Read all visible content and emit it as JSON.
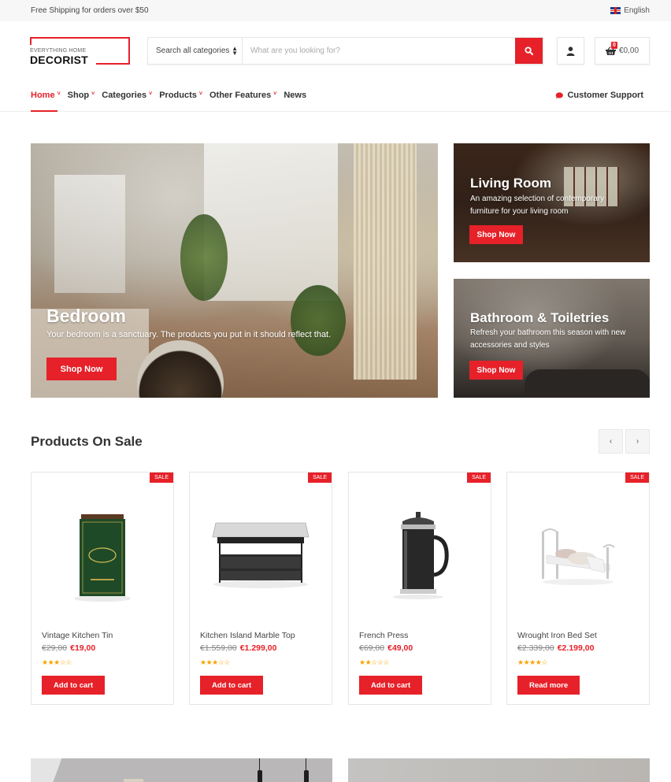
{
  "topbar": {
    "shipping_text": "Free Shipping for orders over $50",
    "language": "English",
    "language_icon": "uk-flag-icon"
  },
  "header": {
    "logo": {
      "tagline": "EVERYTHING HOME",
      "name": "DECORIST"
    },
    "search": {
      "category_select": "Search all categories",
      "placeholder": "What are you looking for?",
      "value": "",
      "button_icon": "search-icon"
    },
    "account_icon": "user-icon",
    "cart": {
      "icon": "basket-icon",
      "count": "0",
      "total": "€0,00"
    }
  },
  "nav": {
    "items": [
      {
        "label": "Home",
        "dropdown": true,
        "active": true
      },
      {
        "label": "Shop",
        "dropdown": true
      },
      {
        "label": "Categories",
        "dropdown": true
      },
      {
        "label": "Products",
        "dropdown": true
      },
      {
        "label": "Other Features",
        "dropdown": true
      },
      {
        "label": "News",
        "dropdown": false
      }
    ],
    "support": {
      "label": "Customer Support",
      "icon": "chat-bubble-icon"
    }
  },
  "banners": [
    {
      "title": "Bedroom",
      "description": "Your bedroom is a sanctuary. The products you put in it should reflect that.",
      "button": "Shop Now"
    },
    {
      "title": "Living Room",
      "description": "An amazing selection of contemporary furniture for your living room",
      "button": "Shop Now"
    },
    {
      "title": "Bathroom & Toiletries",
      "description": "Refresh your bathroom this season with new accessories and styles",
      "button": "Shop Now"
    }
  ],
  "products_section": {
    "title": "Products On Sale",
    "prev_icon": "chevron-left-icon",
    "next_icon": "chevron-right-icon",
    "products": [
      {
        "badge": "SALE",
        "name": "Vintage Kitchen Tin",
        "old_price": "€29,00",
        "price": "€19,00",
        "rating": 3,
        "rating_max": 5,
        "button": "Add to cart"
      },
      {
        "badge": "SALE",
        "name": "Kitchen Island Marble Top",
        "old_price": "€1.559,00",
        "price": "€1.299,00",
        "rating": 3,
        "rating_max": 5,
        "button": "Add to cart"
      },
      {
        "badge": "SALE",
        "name": "French Press",
        "old_price": "€69,00",
        "price": "€49,00",
        "rating": 2,
        "rating_max": 5,
        "button": "Add to cart"
      },
      {
        "badge": "SALE",
        "name": "Wrought Iron Bed Set",
        "old_price": "€2.339,00",
        "price": "€2.199,00",
        "rating": 4,
        "rating_max": 5,
        "button": "Read more"
      }
    ]
  },
  "colors": {
    "accent": "#e62129",
    "star": "#f7a400",
    "text": "#333333"
  }
}
